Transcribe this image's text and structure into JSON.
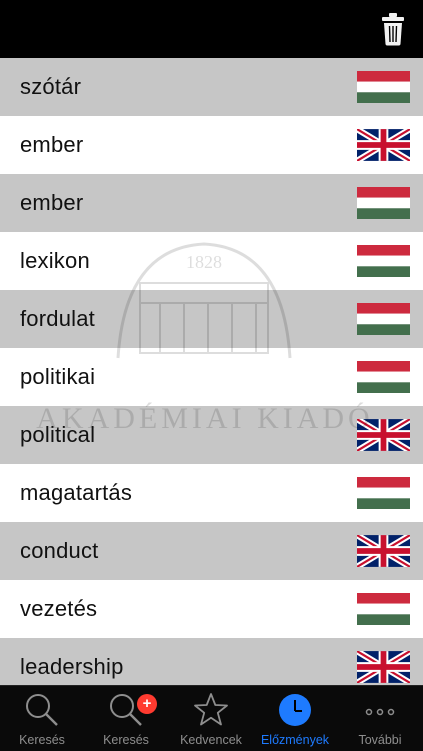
{
  "header": {
    "trash_icon": "trash-icon"
  },
  "watermark": {
    "year": "1828",
    "publisher": "AKADÉMIAI KIADÓ"
  },
  "history": [
    {
      "word": "szótár",
      "lang": "hu"
    },
    {
      "word": "ember",
      "lang": "en"
    },
    {
      "word": "ember",
      "lang": "hu"
    },
    {
      "word": "lexikon",
      "lang": "hu"
    },
    {
      "word": "fordulat",
      "lang": "hu"
    },
    {
      "word": "politikai",
      "lang": "hu"
    },
    {
      "word": "political",
      "lang": "en"
    },
    {
      "word": "magatartás",
      "lang": "hu"
    },
    {
      "word": "conduct",
      "lang": "en"
    },
    {
      "word": "vezetés",
      "lang": "hu"
    },
    {
      "word": "leadership",
      "lang": "en"
    }
  ],
  "tabs": [
    {
      "label": "Keresés",
      "icon": "search-icon"
    },
    {
      "label": "Keresés",
      "icon": "search-plus-icon",
      "badge": "+"
    },
    {
      "label": "Kedvencek",
      "icon": "star-icon"
    },
    {
      "label": "Előzmények",
      "icon": "clock-icon",
      "active": true
    },
    {
      "label": "További",
      "icon": "more-icon"
    }
  ],
  "colors": {
    "accent": "#1e7bff",
    "badge": "#ff3b30",
    "row_alt": "#c6c6c6"
  }
}
